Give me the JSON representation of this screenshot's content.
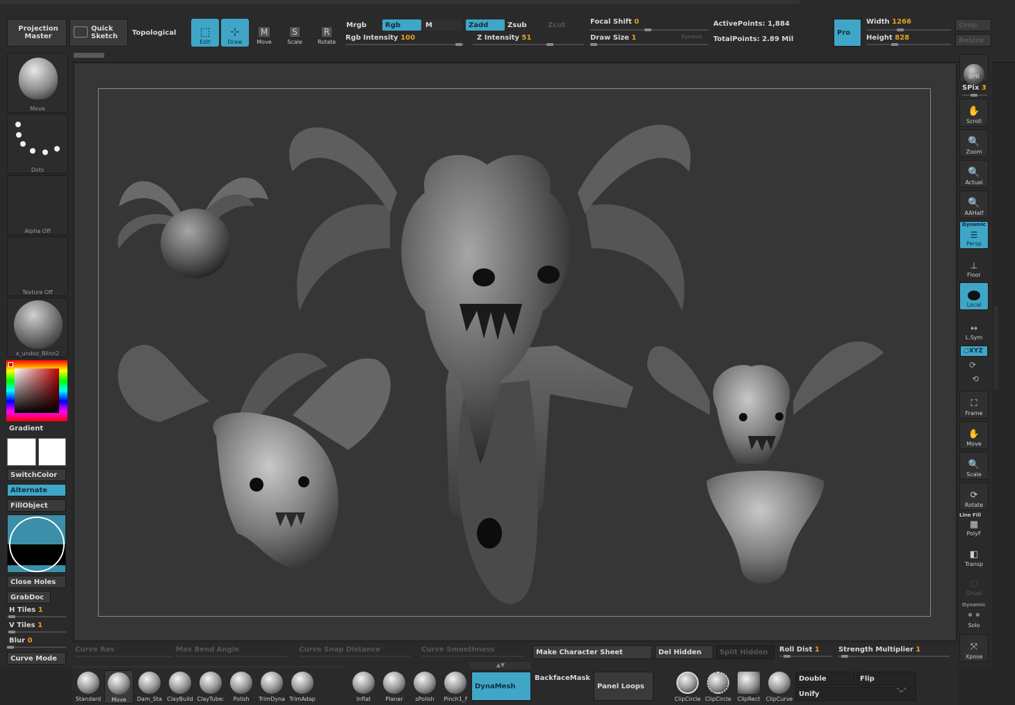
{
  "top": {
    "projection_master": "Projection\nMaster",
    "quick_sketch": "Quick\nSketch",
    "topological": "Topological",
    "edit": "Edit",
    "draw": "Draw",
    "move": "Move",
    "scale": "Scale",
    "rotate": "Rotate",
    "mrgb": "Mrgb",
    "rgb": "Rgb",
    "m": "M",
    "rgb_intensity_label": "Rgb Intensity",
    "rgb_intensity_value": "100",
    "zadd": "Zadd",
    "zsub": "Zsub",
    "zcut": "Zcut",
    "z_intensity_label": "Z Intensity",
    "z_intensity_value": "51",
    "focal_shift_label": "Focal Shift",
    "focal_shift_value": "0",
    "draw_size_label": "Draw Size",
    "draw_size_value": "1",
    "dynamic": "Dynamic",
    "active_points_label": "ActivePoints:",
    "active_points_value": "1,884",
    "total_points_label": "TotalPoints:",
    "total_points_value": "2.89 Mil",
    "pro": "Pro",
    "width_label": "Width",
    "width_value": "1266",
    "height_label": "Height",
    "height_value": "828",
    "crop": "Crop",
    "resize": "Resize"
  },
  "left": {
    "brush_caption": "Move",
    "stroke_caption": "Dots",
    "alpha_caption": "Alpha Off",
    "texture_caption": "Texture Off",
    "material_caption": "x_undoz_Blinn2",
    "gradient": "Gradient",
    "switchcolor": "SwitchColor",
    "alternate": "Alternate",
    "fillobject": "FillObject",
    "close_holes": "Close Holes",
    "grabdoc": "GrabDoc",
    "h_tiles_label": "H Tiles",
    "h_tiles_value": "1",
    "v_tiles_label": "V Tiles",
    "v_tiles_value": "1",
    "blur_label": "Blur",
    "blur_value": "0",
    "curve_mode": "Curve Mode"
  },
  "right": {
    "bpr": "BPR",
    "spix_label": "SPix",
    "spix_value": "3",
    "scroll": "Scroll",
    "zoom": "Zoom",
    "actual": "Actual",
    "aahalf": "AAHalf",
    "dynamic": "Dynamic",
    "persp": "Persp",
    "floor": "Floor",
    "local": "Local",
    "lsym": "L.Sym",
    "xyz": "○XYZ",
    "frame": "Frame",
    "move": "Move",
    "scale": "Scale",
    "rotate": "Rotate",
    "line_fill": "Line Fill",
    "polyf": "PolyF",
    "transp": "Transp",
    "ghost": "Ghost",
    "dynamic2": "Dynamic",
    "solo": "Solo",
    "xpose": "Xpose"
  },
  "bottom": {
    "curve_res": "Curve Res",
    "max_bend_angle": "Max Bend Angle",
    "curve_snap_distance": "Curve Snap Distance",
    "curve_smoothness": "Curve Smoothness",
    "make_character_sheet": "Make Character Sheet",
    "del_hidden": "Del Hidden",
    "split_hidden": "Split Hidden",
    "roll_dist_label": "Roll Dist",
    "roll_dist_value": "1",
    "strength_multiplier_label": "Strength Multiplier",
    "strength_multiplier_value": "1",
    "brushes": [
      "Standard",
      "Move",
      "Dam_Sta",
      "ClayBuild",
      "ClayTube:",
      "Polish",
      "TrimDyna",
      "TrimAdap"
    ],
    "brushes2": [
      "Inflat",
      "Planar",
      "sPolish",
      "Pinch1_f"
    ],
    "dynamesh": "DynaMesh",
    "backfacemask": "BackfaceMask",
    "panel_loops": "Panel Loops",
    "clips": [
      "ClipCircle",
      "ClipCircle",
      "ClipRect",
      "ClipCurve"
    ],
    "double": "Double",
    "flip": "Flip",
    "unify": "Unify"
  },
  "colors": {
    "accent": "#3fa6c8",
    "value": "#e8a020",
    "canvas": "#363636"
  }
}
